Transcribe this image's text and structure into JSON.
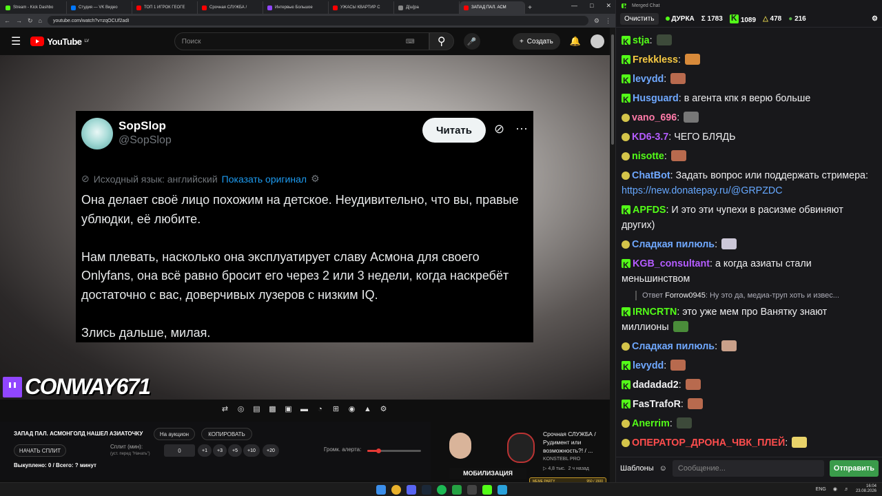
{
  "browser": {
    "tabs": [
      {
        "label": "Stream - Kick Dashbo",
        "color": "#53fc18"
      },
      {
        "label": "Студия — VK Видео",
        "color": "#0077ff"
      },
      {
        "label": "ТОП 1 ИГРОК ГЕОГЕ",
        "color": "#ff0000"
      },
      {
        "label": "Срочная СЛУЖБА /",
        "color": "#ff0000"
      },
      {
        "label": "Интервью Большое",
        "color": "#9146ff"
      },
      {
        "label": "УЖАСЫ КВАРТИР С",
        "color": "#ff0000"
      },
      {
        "label": "Д[ш]ра",
        "color": "#888888"
      },
      {
        "label": "ЗАПАД ПАЛ. АСМ",
        "color": "#ff0000"
      }
    ],
    "url": "youtube.com/watch?v=zqOCUf2adI"
  },
  "youtube": {
    "logo": "YouTube",
    "country": "LV",
    "search_placeholder": "Поиск",
    "create": "Создать"
  },
  "tweet": {
    "name": "SopSlop",
    "handle": "@SopSlop",
    "read_btn": "Читать",
    "lang_note": "Исходный язык: английский",
    "show_original": "Показать оригинал",
    "paragraphs": [
      "Она делает своё лицо похожим на детское. Неудивительно, что вы, правые ублюдки, её любите.",
      "Нам плевать, насколько она эксплуатирует славу Асмона для своего Onlyfans, она всё равно бросит его через 2 или 3 недели, когда наскребёт достаточно с вас, доверчивых лузеров с низким IQ.",
      "Злись дальше, милая."
    ]
  },
  "overlay": {
    "channel": "CONWAY671"
  },
  "auction": {
    "title": "ЗАПАД ПАЛ. АСМОНГОЛД НАШЕЛ АЗИАТОЧКУ",
    "on_auction": "На аукцион",
    "copy": "КОПИРОВАТЬ",
    "start_split": "НАЧАТЬ СПЛИТ",
    "split_label": "Сплит (мин):",
    "split_hint": "(уст. перед \"Начать\")",
    "split_value": "0",
    "increments": [
      "+1",
      "+3",
      "+5",
      "+10",
      "+20"
    ],
    "volume_label": "Громк. алерта:",
    "volume_fraction": 0.2,
    "status": "Выкуплено: 0 / Всего: ? минут"
  },
  "recommendation": {
    "title": "Срочная СЛУЖБА / Рудимент или возможность?! / ...",
    "channel": "KONSTEBL PRO",
    "views": "4,8 тыс.",
    "age": "2 ч назад",
    "thumb_text": "МОБИЛИЗАЦИЯ"
  },
  "meme_bar": {
    "label": "MEME PARTY",
    "value": "950 / 1500"
  },
  "chat": {
    "window_title": "Merged Chat",
    "clear": "Очистить",
    "streamer": "ДУРКА",
    "stats": [
      "Σ 1783",
      "1089",
      "478",
      "216"
    ],
    "messages": [
      {
        "user": "stja",
        "text": "",
        "badge": "k",
        "color": "#53fc18",
        "emote": "#3d4a3a"
      },
      {
        "user": "Frekkless",
        "text": "",
        "badge": "k",
        "color": "#f5c842",
        "emote": "#d88a3a"
      },
      {
        "user": "levydd",
        "text": "",
        "badge": "k",
        "color": "#6fa8ff",
        "emote": "#b86a4e"
      },
      {
        "user": "Husguard",
        "text": "в агента кпк я верю больше",
        "badge": "k",
        "color": "#6fa8ff"
      },
      {
        "user": "vano_696",
        "text": "",
        "badge": "g",
        "color": "#ff7aa8",
        "emote": "#777777"
      },
      {
        "user": "KD6-3.7",
        "text": "ЧЕГО БЛЯДЬ",
        "badge": "g",
        "color": "#b45cff"
      },
      {
        "user": "nisotte",
        "text": "",
        "badge": "g",
        "color": "#53fc18",
        "emote": "#b86a4e"
      },
      {
        "user": "ChatBot",
        "text": "Задать вопрос или поддержать стримера:",
        "link": "https://new.donatepay.ru/@GRPZDC",
        "badge": "g",
        "color": "#6fa8ff"
      },
      {
        "user": "APFDS",
        "text": "И это эти чупехи в расизме обвиняют других)",
        "badge": "k",
        "color": "#53fc18"
      },
      {
        "user": "Сладкая пилюль",
        "text": "",
        "badge": "g",
        "color": "#6fa8ff",
        "emote": "#ccc7d8"
      },
      {
        "user": "KGB_consultant",
        "text": "а когда азиаты стали меньшинством",
        "badge": "k",
        "color": "#b45cff"
      },
      {
        "reply": true,
        "text": "Ответ",
        "reply_user": "Forrow0945",
        "reply_text": ": Ну это да, медиа-труп хоть и извес..."
      },
      {
        "user": "IRNCRTN",
        "text": "это уже мем про Ванятку знают миллионы",
        "badge": "k",
        "color": "#53fc18",
        "emote": "#4a8c3a"
      },
      {
        "user": "Сладкая пилюль",
        "text": "",
        "badge": "g",
        "color": "#6fa8ff",
        "emote": "#c9a08a"
      },
      {
        "user": "levydd",
        "text": "",
        "badge": "k",
        "color": "#6fa8ff",
        "emote": "#b86a4e"
      },
      {
        "user": "dadadad2",
        "text": "",
        "badge": "k",
        "color": "#efeff1",
        "emote": "#b86a4e"
      },
      {
        "user": "FasTrafoR",
        "text": "",
        "badge": "k",
        "color": "#efeff1",
        "emote": "#b86a4e"
      },
      {
        "user": "Anerrim",
        "text": "",
        "badge": "g",
        "color": "#53fc18",
        "emote": "#3d4a3a"
      },
      {
        "user": "ОПЕРАТОР_ДРОНА_ЧВК_ПЛЕЙ",
        "text": "",
        "badge": "g",
        "color": "#ff4d4d",
        "emote": "#e9d36a"
      }
    ],
    "templates": "Шаблоны",
    "placeholder": "Сообщение...",
    "send": "Отправить"
  },
  "taskbar": {
    "lang": "ENG",
    "time": "16:04",
    "date": "23.08.2026"
  }
}
